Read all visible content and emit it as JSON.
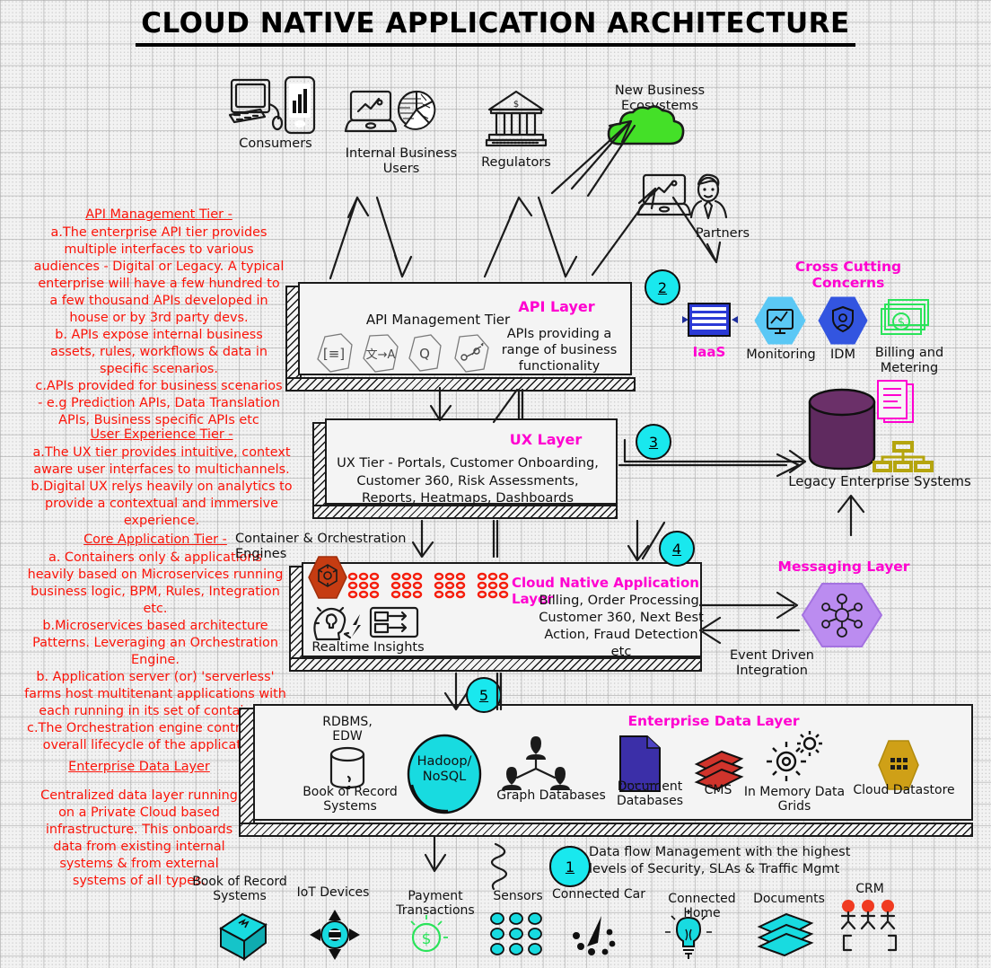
{
  "title": "CLOUD NATIVE APPLICATION ARCHITECTURE",
  "top_actors": [
    {
      "id": "consumers",
      "label": "Consumers"
    },
    {
      "id": "internal-business-users",
      "label": "Internal Business Users"
    },
    {
      "id": "regulators",
      "label": "Regulators"
    },
    {
      "id": "new-business-ecosystems",
      "label": "New Business Ecosystems"
    },
    {
      "id": "partners",
      "label": "Partners"
    }
  ],
  "notes": {
    "api_tier": {
      "heading": "API Management Tier -",
      "body": "a.The enterprise API tier provides multiple interfaces to various audiences - Digital or Legacy. A typical enterprise will have a few hundred to a few thousand APIs developed in house or by 3rd party devs.\nb. APIs expose internal business assets, rules, workflows & data in specific scenarios.\nc.APIs provided for business scenarios - e.g Prediction APIs, Data Translation APIs, Business specific APIs etc"
    },
    "ux_tier": {
      "heading": "User Experience  Tier -",
      "body": "a.The UX tier provides intuitive, context aware user interfaces to multichannels.\nb.Digital UX relys heavily on analytics to provide a contextual and immersive experience."
    },
    "core_tier": {
      "heading": "Core Application Tier -",
      "body": "a. Containers only & applications heavily based on Microservices running business logic, BPM, Rules, Integration etc.\nb.Microservices based architecture Patterns. Leveraging an Orchestration Engine.\nb. Application server (or) 'serverless' farms host multitenant applications with each running in its set of containers\nc.The Orchestration engine controls the overall lifecycle of the applications"
    },
    "data_layer": {
      "heading": "Enterprise Data Layer",
      "body": "Centralized data layer running on a Private Cloud based infrastructure. This onboards data from existing internal systems & from external systems  of all types."
    }
  },
  "layers": {
    "api": {
      "badge": "2",
      "title": "API Layer",
      "tier_label": "API Management Tier",
      "description": "APIs providing a range of business functionality",
      "icons": [
        {
          "name": "api-spec-icon",
          "glyph": "[≡]"
        },
        {
          "name": "api-translate-icon",
          "glyph": "文→A"
        },
        {
          "name": "api-search-icon",
          "glyph": "Q"
        },
        {
          "name": "api-routing-icon",
          "glyph": "∿"
        }
      ]
    },
    "ux": {
      "badge": "3",
      "title": "UX Layer",
      "description": "UX Tier - Portals, Customer Onboarding, Customer 360, Risk Assessments, Reports, Heatmaps, Dashboards"
    },
    "core": {
      "badge": "4",
      "title": "Cloud Native Application Layer",
      "description": "Billing, Order Processing, Customer 360, Next Best Action, Fraud Detection etc",
      "container_label": "Container & Orchestration Engines",
      "realtime_label": "Realtime Insights",
      "container_clusters": 4,
      "dots_per_cluster": 9
    },
    "data": {
      "badge": "5",
      "title": "Enterprise Data Layer",
      "items": [
        {
          "name": "book-of-record-systems",
          "top_label": "RDBMS,\nEDW",
          "label": "Book of Record\nSystems"
        },
        {
          "name": "hadoop-nosql",
          "label": "Hadoop/\nNoSQL"
        },
        {
          "name": "graph-databases",
          "label": "Graph Databases"
        },
        {
          "name": "document-databases",
          "label": "Document\nDatabases"
        },
        {
          "name": "cms",
          "label": "CMS"
        },
        {
          "name": "in-memory-data-grids",
          "label": "In Memory Data\nGrids"
        },
        {
          "name": "cloud-datastore",
          "label": "Cloud Datastore"
        }
      ]
    }
  },
  "cross_cutting": {
    "title": "Cross Cutting Concerns",
    "items": [
      {
        "name": "iaas",
        "label": "IaaS",
        "label_color": "#ff00d0",
        "color": "#2b3ad6"
      },
      {
        "name": "monitoring",
        "label": "Monitoring",
        "label_color": "#111111",
        "color": "#5bc8f5"
      },
      {
        "name": "idm",
        "label": "IDM",
        "label_color": "#111111",
        "color": "#3355e0"
      },
      {
        "name": "billing-and-metering",
        "label": "Billing and\nMetering",
        "label_color": "#111111",
        "color": "#2ae35a"
      }
    ]
  },
  "right_side": {
    "legacy_label": "Legacy Enterprise Systems",
    "messaging_title": "Messaging Layer",
    "event_driven_label": "Event Driven\nIntegration"
  },
  "bottom": {
    "dataflow_badge": "1",
    "dataflow_text": "Data flow Management with the highest levels of Security, SLAs & Traffic Mgmt",
    "sources": [
      {
        "name": "book-of-record-systems-source",
        "label": "Book of Record\nSystems"
      },
      {
        "name": "iot-devices",
        "label": "IoT Devices"
      },
      {
        "name": "payment-transactions",
        "label": "Payment\nTransactions"
      },
      {
        "name": "sensors",
        "label": "Sensors"
      },
      {
        "name": "connected-car",
        "label": "Connected Car"
      },
      {
        "name": "connected-home",
        "label": "Connected Home"
      },
      {
        "name": "documents",
        "label": "Documents"
      },
      {
        "name": "crm",
        "label": "CRM"
      }
    ]
  },
  "colors": {
    "red_note": "#fb1409",
    "magenta": "#ff00d0",
    "cyan_badge": "#19e8ee",
    "cyan_icon": "#18dbe0",
    "green_cloud": "#44e028",
    "purple_cylinder": "#5f2a5f",
    "purple_hex": "#bb8cf0",
    "orange_hex": "#c63c12",
    "gold": "#cfa017"
  }
}
